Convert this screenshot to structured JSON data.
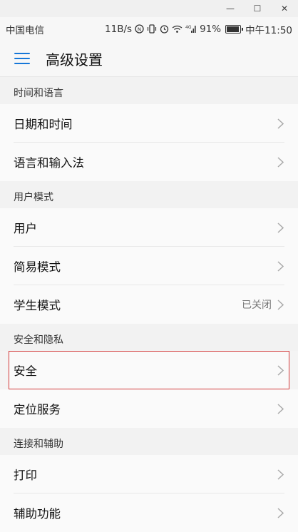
{
  "window": {
    "minimize_glyph": "—",
    "maximize_glyph": "☐",
    "close_glyph": "✕"
  },
  "status": {
    "carrier": "中国电信",
    "net_speed": "11B/s",
    "signal_text": "4G",
    "battery_pct": "91%",
    "time": "中午11:50",
    "icons": [
      "data-icon",
      "vibrate-icon",
      "alarm-icon",
      "wifi-icon",
      "signal-icon",
      "battery-icon"
    ]
  },
  "header": {
    "title": "高级设置"
  },
  "sections": [
    {
      "header": "时间和语言",
      "items": [
        {
          "label": "日期和时间"
        },
        {
          "label": "语言和输入法"
        }
      ]
    },
    {
      "header": "用户模式",
      "items": [
        {
          "label": "用户"
        },
        {
          "label": "简易模式"
        },
        {
          "label": "学生模式",
          "value": "已关闭"
        }
      ]
    },
    {
      "header": "安全和隐私",
      "items": [
        {
          "label": "安全"
        },
        {
          "label": "定位服务"
        }
      ]
    },
    {
      "header": "连接和辅助",
      "items": [
        {
          "label": "打印"
        },
        {
          "label": "辅助功能"
        }
      ]
    }
  ],
  "colors": {
    "accent": "#1677d8",
    "highlight_border": "#d23a3a"
  }
}
